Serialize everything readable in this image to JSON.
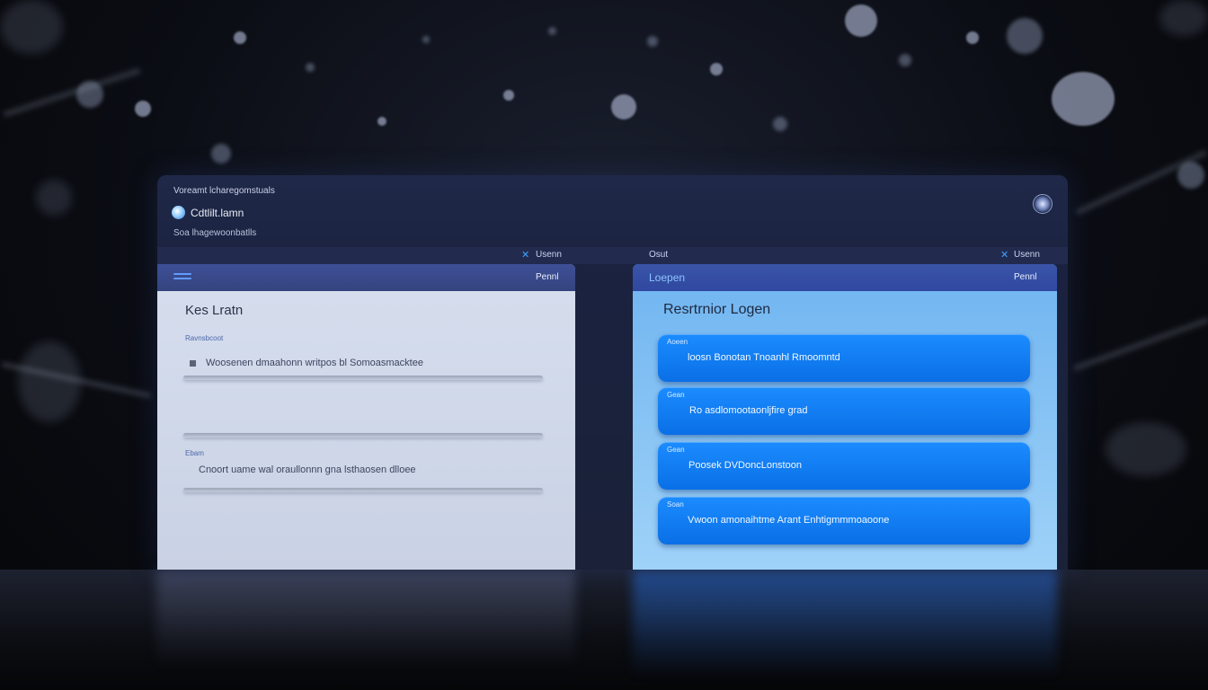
{
  "window": {
    "subtitle_top": "Voreamt lcharegomstuals",
    "app_name": "Cdtlilt.lamn",
    "subtitle_bottom": "Soa lhagewoonbatlls"
  },
  "tabbar": {
    "left_tab": "Usenn",
    "middle_tab": "Osut",
    "right_tab": "Usenn"
  },
  "left_panel": {
    "header_action": "Pennl",
    "title": "Kes Lratn",
    "section1_label": "Ravnsbcoot",
    "row1_text": "Woosenen dmaahonn writpos bl Somoasmacktee",
    "section2_label": "Ebam",
    "row2_text": "Cnoort uame wal oraullonnn gna lsthaosen dlloee"
  },
  "right_panel": {
    "header_title": "Loepen",
    "header_action": "Pennl",
    "title": "Resrtrnior Logen",
    "cards": [
      {
        "label": "Aoeen",
        "text": "loosn Bonotan Tnoanhl Rmoomntd"
      },
      {
        "label": "Gean",
        "text": "Ro asdlomootaonljfire grad"
      },
      {
        "label": "Gean",
        "text": "Poosek DVDoncLonstoon"
      },
      {
        "label": "Soan",
        "text": "Vwoon amonaihtme Arant Enhtigmmmoaoone"
      }
    ]
  },
  "colors": {
    "accent_blue": "#0a6fe6",
    "header_blue": "#34447f",
    "window_bg": "#1b2342"
  }
}
